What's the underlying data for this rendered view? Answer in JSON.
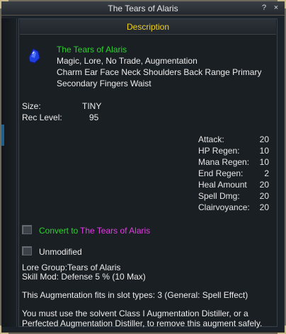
{
  "window": {
    "title": "The Tears of Alaris",
    "help_label": "?",
    "close_label": "×"
  },
  "description": {
    "header": "Description",
    "item_name": "The Tears of Alaris",
    "flags": "Magic, Lore, No Trade, Augmentation",
    "slots_line1": "Charm Ear Face Neck Shoulders Back Range Primary",
    "slots_line2": "Secondary Fingers Waist",
    "size_label": "Size:",
    "size_value": "TINY",
    "rec_level_label": "Rec Level:",
    "rec_level_value": "95",
    "stats": [
      {
        "label": "Attack:",
        "value": "20"
      },
      {
        "label": "HP Regen:",
        "value": "10"
      },
      {
        "label": "Mana Regen:",
        "value": "10"
      },
      {
        "label": "End Regen:",
        "value": "2"
      },
      {
        "label": "Heal Amount",
        "value": "20"
      },
      {
        "label": "Spell Dmg:",
        "value": "20"
      },
      {
        "label": "Clairvoyance:",
        "value": "20"
      }
    ],
    "convert_prefix": "Convert to",
    "convert_target": "The Tears of Alaris",
    "unmodified_label": "Unmodified",
    "lore_group": "Lore Group:Tears of Alaris",
    "skill_mod": "Skill Mod: Defense 5 % (10 Max)",
    "fits_slot_types": "This Augmentation fits in slot types: 3 (General: Spell Effect)",
    "distiller_line1": "You must use the solvent Class I Augmentation Distiller, or a",
    "distiller_line2": "Perfected Augmentation Distiller, to remove this augment safely."
  },
  "colors": {
    "item_name": "#2fd12f",
    "header": "#f2d21a",
    "convert_target": "#e23ce2",
    "gem": "#1f3fe0"
  },
  "icons": {
    "item": "blue-gem-icon"
  }
}
